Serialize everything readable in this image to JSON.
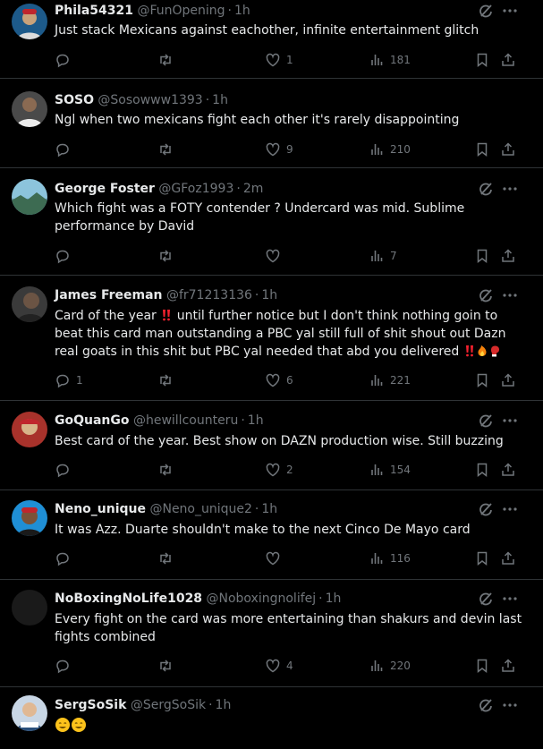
{
  "tweets": [
    {
      "name": "Phila54321",
      "handle": "@FunOpening",
      "time": "1h",
      "text": "Just stack Mexicans against eachother, infinite entertainment glitch",
      "replies": "",
      "retweets": "",
      "likes": "1",
      "views": "181",
      "avatar_color": "#1d5a8a"
    },
    {
      "name": "SOSO",
      "handle": "@Sosowww1393",
      "time": "1h",
      "text": "Ngl when two mexicans fight each other it's rarely disappointing",
      "replies": "",
      "retweets": "",
      "likes": "9",
      "views": "210",
      "avatar_color": "#4a4a4a"
    },
    {
      "name": "George Foster",
      "handle": "@GFoz1993",
      "time": "2m",
      "text": "Which fight was a FOTY contender ? Undercard was mid. Sublime performance by David",
      "replies": "",
      "retweets": "",
      "likes": "",
      "views": "7",
      "avatar_color": "#7bb3c9"
    },
    {
      "name": "James Freeman",
      "handle": "@fr71213136",
      "time": "1h",
      "text": "Card of the year",
      "text_rest": " until further notice but I don't think nothing goin to beat this card man outstanding a PBC yal still full of shit shout out Dazn real goats in this shit but PBC yal needed that abd you delivered",
      "replies": "1",
      "retweets": "",
      "likes": "6",
      "views": "221",
      "avatar_color": "#3a3a3a"
    },
    {
      "name": "GoQuanGo",
      "handle": "@hewillcounteru",
      "time": "1h",
      "text": "Best card of the year. Best show on DAZN production wise. Still buzzing",
      "replies": "",
      "retweets": "",
      "likes": "2",
      "views": "154",
      "avatar_color": "#a8322b"
    },
    {
      "name": "Neno_unique",
      "handle": "@Neno_unique2",
      "time": "1h",
      "text": "It was Azz. Duarte shouldn't make to the next Cinco De Mayo card",
      "replies": "",
      "retweets": "",
      "likes": "",
      "views": "116",
      "avatar_color": "#1f8fd6"
    },
    {
      "name": "NoBoxingNoLife1028",
      "handle": "@Noboxingnolifej",
      "time": "1h",
      "text": "Every fight on the card was more entertaining than shakurs and devin last fights combined",
      "replies": "",
      "retweets": "",
      "likes": "4",
      "views": "220",
      "avatar_color": "#1a1a1a"
    },
    {
      "name": "SergSoSik",
      "handle": "@SergSoSik",
      "time": "1h",
      "text": "",
      "replies": "",
      "retweets": "",
      "likes": "",
      "views": "",
      "avatar_color": "#5d7fa8"
    }
  ],
  "colors": {
    "background": "#000000",
    "text": "#e7e9ea",
    "muted": "#71767b",
    "divider": "#2f3336",
    "emoji_red": "#f4212e"
  },
  "icons": [
    "reply-icon",
    "retweet-icon",
    "like-icon",
    "views-icon",
    "bookmark-icon",
    "share-icon",
    "grok-icon",
    "more-icon"
  ]
}
